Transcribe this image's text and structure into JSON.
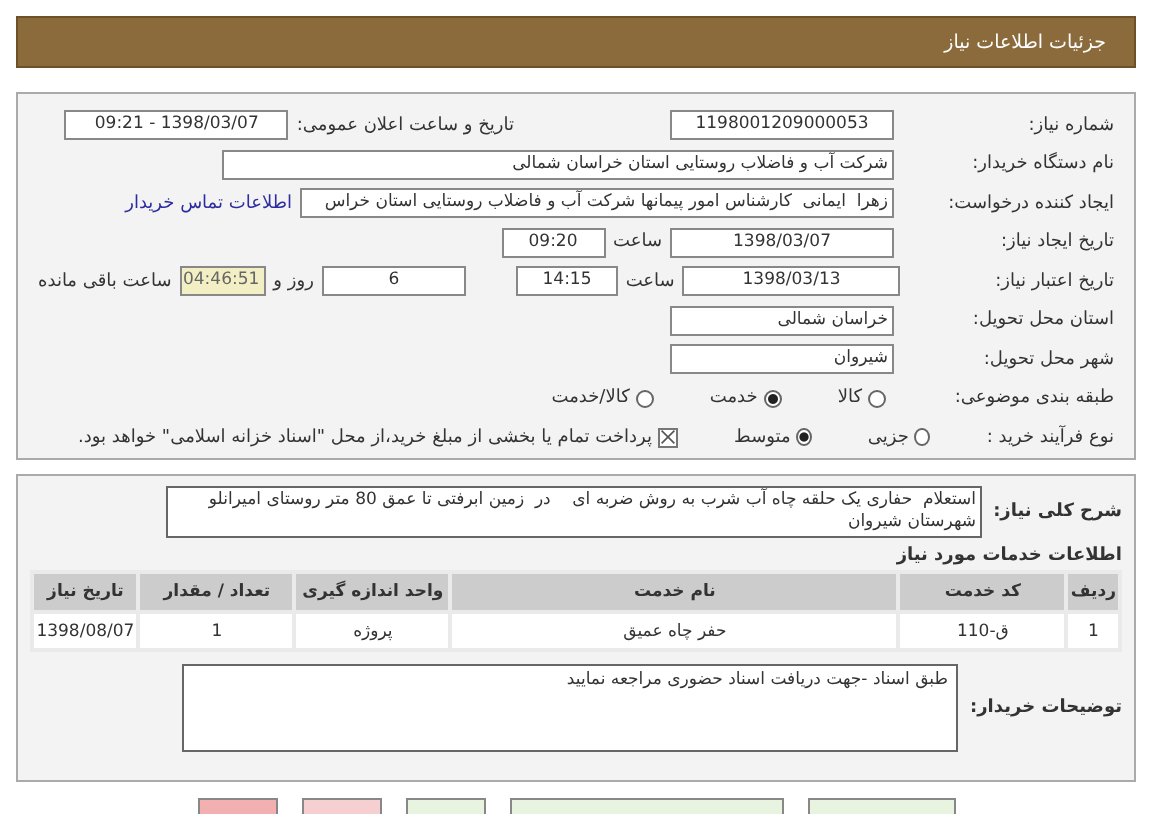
{
  "header": {
    "title": "جزئیات اطلاعات نیاز"
  },
  "details": {
    "need_number": {
      "label": "شماره نیاز:",
      "value": "1198001209000053"
    },
    "announce": {
      "label": "تاریخ و ساعت اعلان عمومی:",
      "value": "1398/03/07 - 09:21"
    },
    "buyer": {
      "label": "نام دستگاه خریدار:",
      "value": "شرکت آب و فاضلاب روستایی استان خراسان شمالی"
    },
    "creator": {
      "label": "ایجاد کننده درخواست:",
      "value": "زهرا  ایمانی  کارشناس امور پیمانها شرکت آب و فاضلاب روستایی استان خراس",
      "link": "اطلاعات تماس خریدار"
    },
    "created": {
      "label": "تاریخ ایجاد نیاز:",
      "date": "1398/03/07",
      "time_label": "ساعت",
      "time": "09:20"
    },
    "valid": {
      "label": "تاریخ اعتبار نیاز:",
      "date": "1398/03/13",
      "time_label": "ساعت",
      "time": "14:15",
      "days": "6",
      "days_label": "روز و",
      "remaining": "04:46:51",
      "remaining_label": "ساعت باقی مانده"
    },
    "province": {
      "label": "استان محل تحویل:",
      "value": "خراسان شمالی"
    },
    "city": {
      "label": "شهر محل تحویل:",
      "value": "شیروان"
    },
    "category": {
      "label": "طبقه بندی موضوعی:",
      "options": [
        {
          "label": "کالا",
          "selected": false
        },
        {
          "label": "خدمت",
          "selected": true
        },
        {
          "label": "کالا/خدمت",
          "selected": false
        }
      ]
    },
    "process": {
      "label": "نوع فرآیند خرید :",
      "options": [
        {
          "label": "جزیی",
          "selected": false
        },
        {
          "label": "متوسط",
          "selected": true
        }
      ],
      "treasury": {
        "label": "پرداخت تمام یا بخشی از مبلغ خرید،از محل \"اسناد خزانه اسلامی\" خواهد بود.",
        "checked": true
      }
    }
  },
  "need": {
    "label": "شرح کلی نیاز:",
    "value": "استعلام  حفاری یک حلقه چاه آب شرب به روش ضربه ای    در  زمین ابرفتی تا عمق 80 متر روستای امیرانلو شهرستان شیروان",
    "services_title": "اطلاعات خدمات مورد نیاز",
    "table": {
      "columns": [
        "ردیف",
        "کد خدمت",
        "نام خدمت",
        "واحد اندازه گیری",
        "تعداد / مقدار",
        "تاریخ نیاز"
      ],
      "rows": [
        [
          "1",
          "ق-110",
          "حفر چاه عمیق",
          "پروژه",
          "1",
          "1398/08/07"
        ]
      ]
    },
    "notes": {
      "label": "توضیحات خریدار:",
      "value": "طبق اسناد -جهت دریافت اسناد حضوری مراجعه نمایید"
    }
  },
  "buttons": [
    {
      "color": "#e8f4e0"
    },
    {
      "color": "#e8f4e0"
    },
    {
      "color": "#e8f4e0"
    },
    {
      "color": "#f6d0d0"
    },
    {
      "color": "#f2b0b0"
    }
  ]
}
